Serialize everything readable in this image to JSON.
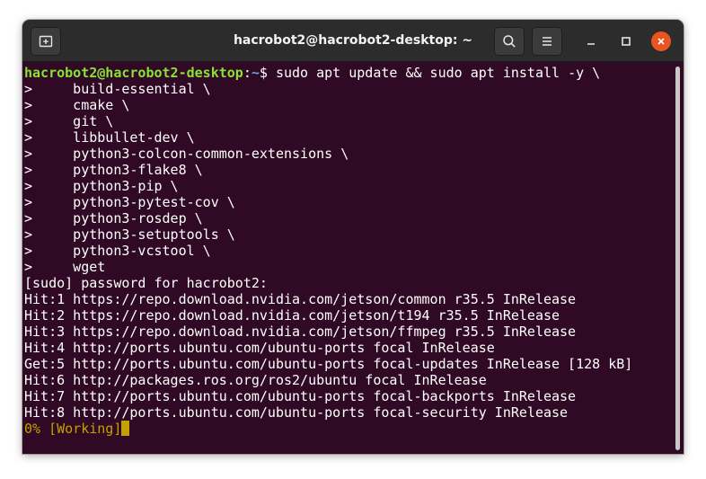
{
  "window": {
    "title": "hacrobot2@hacrobot2-desktop: ~"
  },
  "icons": {
    "new_tab": "new-tab-icon",
    "search": "search-icon",
    "menu": "hamburger-menu-icon",
    "minimize": "minimize-icon",
    "maximize": "maximize-icon",
    "close": "close-icon"
  },
  "colors": {
    "terminal_bg": "#300a24",
    "titlebar_bg": "#2c2c2c",
    "prompt_user": "#8ae234",
    "prompt_path": "#729fcf",
    "progress": "#c4a000",
    "close_button": "#e95420"
  },
  "terminal": {
    "prompt": {
      "user_host": "hacrobot2@hacrobot2-desktop",
      "separator": ":",
      "path": "~",
      "symbol": "$ ",
      "command": "sudo apt update && sudo apt install -y \\"
    },
    "lines": [
      ">     build-essential \\",
      ">     cmake \\",
      ">     git \\",
      ">     libbullet-dev \\",
      ">     python3-colcon-common-extensions \\",
      ">     python3-flake8 \\",
      ">     python3-pip \\",
      ">     python3-pytest-cov \\",
      ">     python3-rosdep \\",
      ">     python3-setuptools \\",
      ">     python3-vcstool \\",
      ">     wget",
      "[sudo] password for hacrobot2:",
      "Hit:1 https://repo.download.nvidia.com/jetson/common r35.5 InRelease",
      "Hit:2 https://repo.download.nvidia.com/jetson/t194 r35.5 InRelease",
      "Hit:3 https://repo.download.nvidia.com/jetson/ffmpeg r35.5 InRelease",
      "Hit:4 http://ports.ubuntu.com/ubuntu-ports focal InRelease",
      "Get:5 http://ports.ubuntu.com/ubuntu-ports focal-updates InRelease [128 kB]",
      "Hit:6 http://packages.ros.org/ros2/ubuntu focal InRelease",
      "Hit:7 http://ports.ubuntu.com/ubuntu-ports focal-backports InRelease",
      "Hit:8 http://ports.ubuntu.com/ubuntu-ports focal-security InRelease"
    ],
    "progress": "0% [Working]"
  }
}
